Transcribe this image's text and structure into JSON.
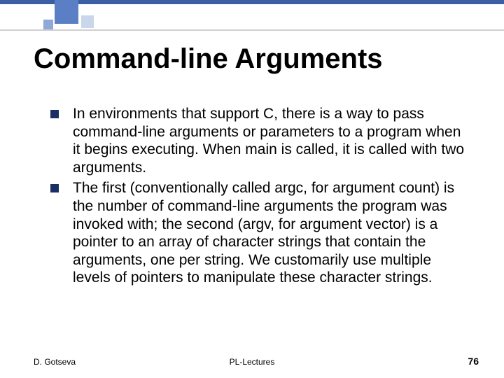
{
  "title": "Command-line Arguments",
  "bullets": [
    "In environments that support C, there is a way to pass command-line arguments or parameters to a program when it begins executing. When main is called, it is called with two arguments.",
    "The first (conventionally called argc, for argument count) is the number of command-line arguments the program was invoked with; the second (argv, for argument vector) is a pointer to an array of character strings that contain the arguments, one per string. We customarily use multiple levels of pointers to manipulate these character strings."
  ],
  "footer": {
    "author": "D. Gotseva",
    "center": "PL-Lectures",
    "page": "76"
  }
}
